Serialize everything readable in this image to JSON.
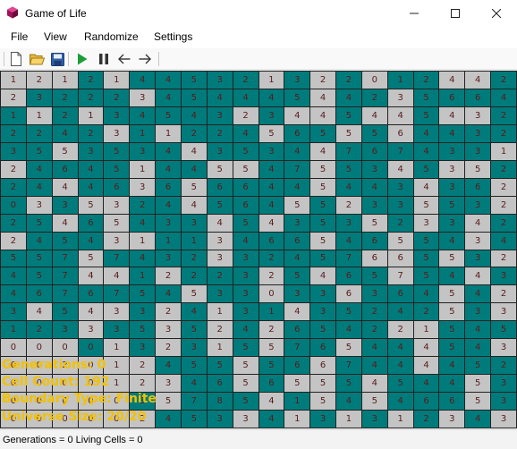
{
  "window": {
    "title": "Game of Life",
    "controls": [
      "minimize",
      "maximize",
      "close"
    ]
  },
  "menu": [
    "File",
    "View",
    "Randomize",
    "Settings"
  ],
  "toolbar": [
    "new-file",
    "open-folder",
    "save",
    "play",
    "pause",
    "step-back",
    "step-forward"
  ],
  "colors": {
    "alive": "#007b7b",
    "dead": "#c4c4c4",
    "grid_line": "#222222",
    "cell_text": "#5a1a1a",
    "overlay_text": "#f2c200"
  },
  "universe": {
    "rows": [
      {
        "v": [
          1,
          2,
          1,
          2,
          1,
          4,
          4,
          5,
          3,
          2,
          1,
          3,
          2,
          2,
          0,
          1,
          2,
          4,
          4,
          2
        ],
        "a": [
          0,
          0,
          0,
          1,
          0,
          1,
          1,
          1,
          1,
          1,
          0,
          1,
          0,
          1,
          0,
          1,
          1,
          0,
          0,
          1
        ]
      },
      {
        "v": [
          2,
          3,
          2,
          2,
          2,
          3,
          4,
          5,
          4,
          4,
          4,
          5,
          4,
          4,
          2,
          3,
          5,
          6,
          6,
          4
        ],
        "a": [
          0,
          1,
          1,
          1,
          1,
          0,
          1,
          1,
          1,
          1,
          1,
          1,
          0,
          1,
          1,
          0,
          1,
          1,
          1,
          1
        ]
      },
      {
        "v": [
          1,
          1,
          2,
          1,
          3,
          4,
          5,
          4,
          3,
          2,
          3,
          4,
          4,
          5,
          4,
          4,
          5,
          4,
          3,
          2
        ],
        "a": [
          1,
          0,
          1,
          0,
          1,
          1,
          1,
          1,
          1,
          0,
          1,
          0,
          0,
          1,
          0,
          0,
          1,
          0,
          0,
          1
        ]
      },
      {
        "v": [
          2,
          2,
          4,
          2,
          3,
          1,
          1,
          2,
          2,
          4,
          5,
          6,
          5,
          5,
          5,
          6,
          4,
          4,
          3,
          2
        ],
        "a": [
          1,
          1,
          1,
          1,
          0,
          1,
          0,
          1,
          1,
          1,
          0,
          1,
          1,
          0,
          1,
          0,
          1,
          1,
          1,
          1
        ]
      },
      {
        "v": [
          3,
          5,
          5,
          3,
          5,
          3,
          4,
          4,
          3,
          5,
          3,
          4,
          4,
          7,
          6,
          7,
          4,
          3,
          3,
          1
        ],
        "a": [
          1,
          1,
          0,
          1,
          1,
          1,
          1,
          0,
          1,
          1,
          1,
          1,
          0,
          1,
          1,
          1,
          1,
          1,
          1,
          0
        ]
      },
      {
        "v": [
          2,
          4,
          6,
          4,
          5,
          1,
          4,
          4,
          5,
          5,
          4,
          7,
          5,
          5,
          3,
          4,
          5,
          3,
          5,
          2
        ],
        "a": [
          0,
          1,
          1,
          1,
          1,
          0,
          1,
          1,
          0,
          0,
          1,
          1,
          0,
          1,
          1,
          0,
          1,
          0,
          0,
          1
        ]
      },
      {
        "v": [
          2,
          4,
          4,
          4,
          6,
          3,
          6,
          5,
          6,
          6,
          4,
          4,
          5,
          4,
          4,
          3,
          4,
          3,
          6,
          2
        ],
        "a": [
          1,
          1,
          0,
          1,
          1,
          0,
          1,
          0,
          1,
          1,
          1,
          1,
          0,
          1,
          1,
          1,
          0,
          1,
          1,
          0
        ]
      },
      {
        "v": [
          0,
          3,
          3,
          5,
          3,
          2,
          4,
          4,
          5,
          6,
          4,
          5,
          5,
          2,
          3,
          3,
          5,
          5,
          3,
          2
        ],
        "a": [
          1,
          0,
          1,
          0,
          0,
          1,
          1,
          0,
          1,
          1,
          1,
          0,
          1,
          0,
          1,
          1,
          0,
          1,
          1,
          0
        ]
      },
      {
        "v": [
          2,
          5,
          4,
          6,
          5,
          4,
          3,
          3,
          4,
          5,
          4,
          3,
          5,
          3,
          5,
          2,
          3,
          3,
          4,
          2
        ],
        "a": [
          1,
          1,
          0,
          1,
          0,
          1,
          1,
          1,
          0,
          1,
          0,
          1,
          1,
          1,
          0,
          1,
          0,
          1,
          0,
          1
        ]
      },
      {
        "v": [
          2,
          4,
          5,
          4,
          3,
          1,
          1,
          1,
          3,
          4,
          6,
          6,
          5,
          4,
          6,
          5,
          5,
          4,
          3,
          4
        ],
        "a": [
          0,
          1,
          1,
          1,
          0,
          0,
          1,
          1,
          0,
          1,
          1,
          1,
          0,
          1,
          1,
          0,
          1,
          1,
          0,
          1
        ]
      },
      {
        "v": [
          5,
          5,
          7,
          5,
          7,
          4,
          3,
          2,
          3,
          3,
          2,
          4,
          5,
          7,
          6,
          6,
          5,
          5,
          3,
          2
        ],
        "a": [
          1,
          1,
          1,
          0,
          1,
          1,
          1,
          1,
          0,
          1,
          1,
          1,
          1,
          1,
          0,
          0,
          1,
          0,
          1,
          0
        ]
      },
      {
        "v": [
          4,
          5,
          7,
          4,
          4,
          1,
          2,
          2,
          2,
          3,
          2,
          5,
          4,
          6,
          5,
          7,
          5,
          4,
          4,
          3
        ],
        "a": [
          1,
          1,
          1,
          0,
          0,
          1,
          0,
          1,
          1,
          1,
          0,
          1,
          0,
          1,
          1,
          0,
          1,
          1,
          0,
          1
        ]
      },
      {
        "v": [
          4,
          6,
          7,
          6,
          7,
          5,
          4,
          5,
          3,
          3,
          0,
          3,
          3,
          6,
          3,
          6,
          4,
          5,
          4,
          2
        ],
        "a": [
          1,
          1,
          1,
          1,
          1,
          1,
          1,
          0,
          1,
          1,
          0,
          1,
          1,
          0,
          1,
          1,
          1,
          0,
          1,
          0
        ]
      },
      {
        "v": [
          3,
          4,
          5,
          4,
          3,
          3,
          2,
          4,
          1,
          3,
          1,
          4,
          3,
          5,
          2,
          4,
          2,
          5,
          3,
          3
        ],
        "a": [
          1,
          0,
          1,
          0,
          0,
          1,
          0,
          1,
          0,
          1,
          1,
          0,
          1,
          1,
          1,
          1,
          1,
          0,
          1,
          0
        ]
      },
      {
        "v": [
          1,
          2,
          3,
          3,
          3,
          5,
          3,
          5,
          2,
          4,
          2,
          6,
          5,
          4,
          2,
          2,
          1,
          5,
          4,
          5
        ],
        "a": [
          1,
          1,
          1,
          0,
          1,
          1,
          0,
          1,
          0,
          1,
          0,
          1,
          1,
          1,
          1,
          0,
          0,
          1,
          1,
          1
        ]
      },
      {
        "v": [
          0,
          0,
          0,
          0,
          1,
          3,
          2,
          3,
          1,
          5,
          5,
          7,
          6,
          5,
          4,
          4,
          4,
          5,
          4,
          3
        ],
        "a": [
          0,
          0,
          0,
          1,
          0,
          1,
          0,
          1,
          0,
          1,
          0,
          1,
          1,
          0,
          1,
          1,
          0,
          1,
          1,
          0
        ]
      },
      {
        "v": [
          0,
          0,
          2,
          0,
          1,
          2,
          4,
          5,
          5,
          5,
          5,
          6,
          6,
          7,
          4,
          4,
          4,
          4,
          5,
          2
        ],
        "a": [
          0,
          0,
          0,
          0,
          0,
          0,
          1,
          1,
          1,
          0,
          1,
          1,
          0,
          1,
          1,
          1,
          0,
          1,
          1,
          1
        ]
      },
      {
        "v": [
          0,
          0,
          0,
          0,
          1,
          2,
          3,
          4,
          6,
          5,
          6,
          5,
          5,
          5,
          4,
          5,
          4,
          4,
          5,
          3
        ],
        "a": [
          0,
          0,
          0,
          0,
          0,
          0,
          0,
          1,
          1,
          0,
          1,
          0,
          0,
          1,
          0,
          1,
          1,
          1,
          0,
          1
        ]
      },
      {
        "v": [
          0,
          0,
          0,
          0,
          0,
          3,
          5,
          7,
          8,
          5,
          4,
          1,
          5,
          4,
          5,
          4,
          6,
          6,
          5,
          3
        ],
        "a": [
          0,
          0,
          0,
          0,
          0,
          1,
          0,
          1,
          1,
          1,
          0,
          1,
          0,
          1,
          0,
          1,
          1,
          1,
          0,
          1
        ]
      },
      {
        "v": [
          0,
          0,
          0,
          0,
          0,
          2,
          4,
          5,
          3,
          3,
          4,
          1,
          3,
          1,
          3,
          1,
          2,
          3,
          4,
          3
        ],
        "a": [
          0,
          0,
          0,
          0,
          0,
          0,
          1,
          1,
          1,
          0,
          1,
          0,
          1,
          0,
          1,
          0,
          1,
          0,
          1,
          0
        ]
      }
    ]
  },
  "overlay": {
    "generations": "Generations: 0",
    "cell_count": "Cell Count: 192",
    "boundary": "Boundary Type: Finite",
    "size": "Universe Size: 20/20"
  },
  "status": "Generations = 0  Living Cells = 0"
}
